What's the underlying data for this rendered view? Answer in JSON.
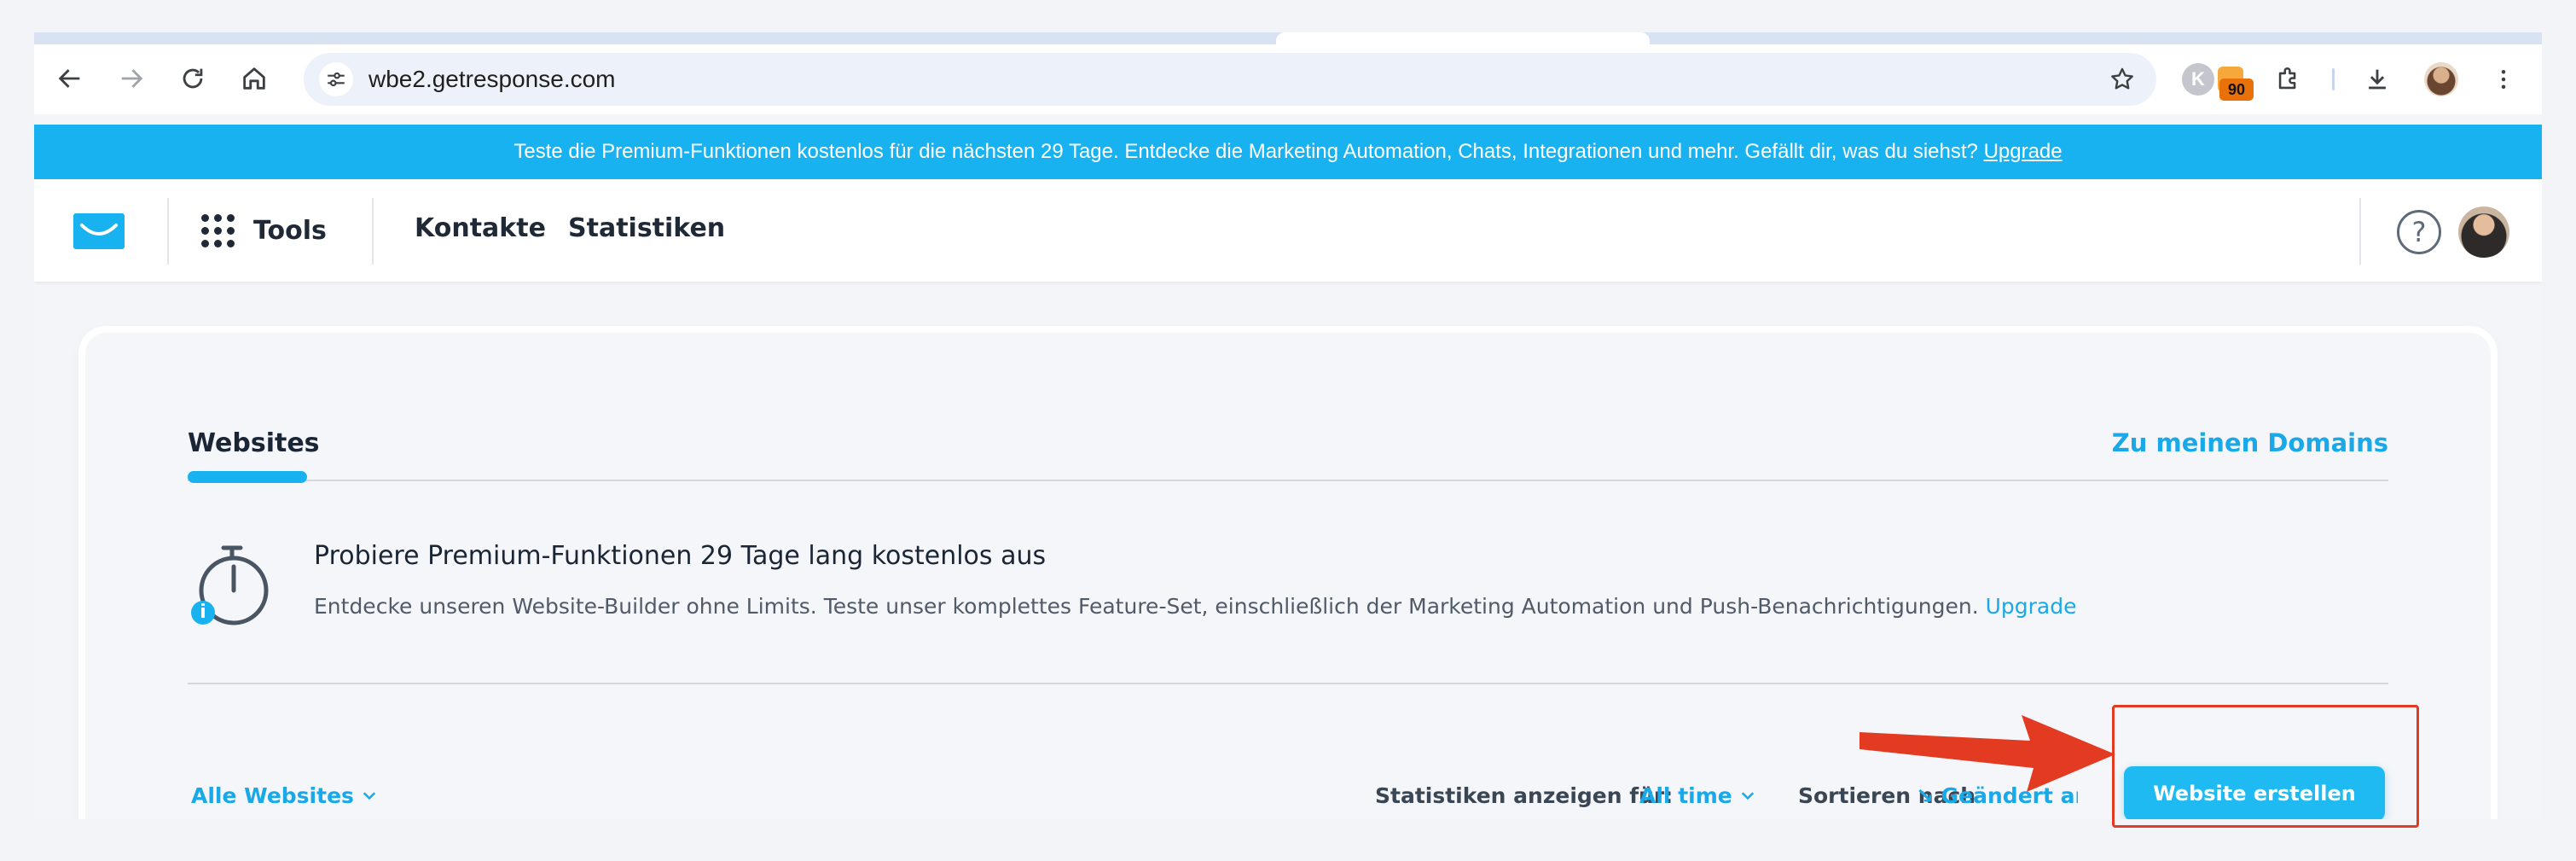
{
  "browser": {
    "url": "wbe2.getresponse.com",
    "icons": {
      "back": "arrow-left-icon",
      "forward": "arrow-right-icon",
      "reload": "reload-icon",
      "home": "home-icon",
      "site_settings": "tune-icon",
      "bookmark": "star-icon",
      "extensions": "puzzle-icon",
      "downloads": "download-icon",
      "menu": "kebab-menu-icon"
    },
    "extension_k_letter": "K",
    "extension_badge_count": "90"
  },
  "banner": {
    "text": "Teste die Premium-Funktionen kostenlos für die nächsten 29 Tage. Entdecke die Marketing Automation, Chats, Integrationen und mehr. Gefällt dir, was du siehst?",
    "link": "Upgrade"
  },
  "header": {
    "tools_label": "Tools",
    "nav": [
      "Kontakte",
      "Statistiken"
    ],
    "help_symbol": "?",
    "colors": {
      "brand": "#19b2f0",
      "text": "#1f2a36"
    }
  },
  "main": {
    "tab_label": "Websites",
    "domains_link": "Zu meinen Domains",
    "promo": {
      "title": "Probiere Premium-Funktionen 29 Tage lang kostenlos aus",
      "text": "Entdecke unseren Website-Builder ohne Limits. Teste unser komplettes Feature-Set, einschließlich der Marketing Automation und Push-Benachrichtigungen.",
      "link": "Upgrade"
    },
    "filter_label": "Alle Websites",
    "stats_label": "Statistiken anzeigen für:",
    "stats_value": "All time",
    "sort_label": "Sortieren nach",
    "sort_value": "Geändert am",
    "create_button": "Website erstellen"
  },
  "annotation": {
    "color": "#e33b22",
    "target": "create-website-button"
  }
}
